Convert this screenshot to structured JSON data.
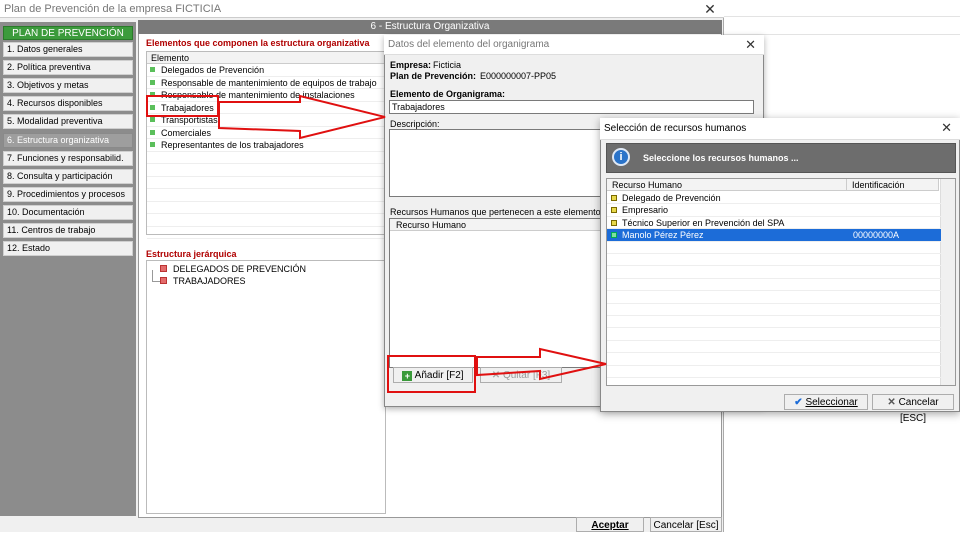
{
  "main": {
    "title": "Plan de Prevención de la empresa FICTICIA",
    "close_glyph": "✕",
    "header": "6 - Estructura Organizativa",
    "nav_title": "PLAN DE PREVENCIÓN",
    "nav_items": [
      "1. Datos generales",
      "2. Política preventiva",
      "3. Objetivos y metas",
      "4. Recursos disponibles",
      "5. Modalidad preventiva",
      "6. Estructura organizativa",
      "7. Funciones y responsabilid.",
      "8. Consulta y participación",
      "9. Procedimientos y procesos",
      "10. Documentación",
      "11. Centros de trabajo",
      "12. Estado"
    ],
    "active_nav_index": 5,
    "elements_title": "Elementos que componen la estructura organizativa",
    "elements_col": "Elemento",
    "elements": [
      "Delegados de Prevención",
      "Responsable de mantenimiento de equipos de trabajo",
      "Responsable de mantenimiento de instalaciones",
      "Trabajadores",
      "Transportistas",
      "Comerciales",
      "Representantes de los trabajadores"
    ],
    "hier_title": "Estructura jerárquica",
    "hier_items": [
      "DELEGADOS DE PREVENCIÓN",
      "TRABAJADORES"
    ],
    "accept_label": "Aceptar",
    "cancel_label": "Cancelar [Esc]"
  },
  "dialog1": {
    "title": "Datos del elemento del organigrama",
    "close_glyph": "✕",
    "empresa_label": "Empresa:",
    "empresa_value": "Ficticia",
    "plan_label": "Plan de Prevención:",
    "plan_value": "E000000007-PP05",
    "elemento_label": "Elemento de Organigrama:",
    "elemento_value": "Trabajadores",
    "descripcion_label": "Descripción:",
    "rh_label": "Recursos Humanos que pertenecen a este elemento del Orga",
    "rh_col": "Recurso Humano",
    "add_label": "Añadir  [F2]",
    "remove_label": "Quitar  [F3]"
  },
  "dialog2": {
    "title": "Selección de recursos humanos",
    "close_glyph": "✕",
    "banner": "Seleccione los recursos humanos ...",
    "info_glyph": "i",
    "col_rh": "Recurso Humano",
    "col_id": "Identificación",
    "rows": [
      {
        "name": "Delegado de Prevención",
        "id": ""
      },
      {
        "name": "Empresario",
        "id": ""
      },
      {
        "name": "Técnico Superior en Prevención del SPA",
        "id": ""
      },
      {
        "name": "Manolo Pérez Pérez",
        "id": "00000000A"
      }
    ],
    "selected_row": 3,
    "select_label": "Seleccionar",
    "cancel_label": "Cancelar [ESC]"
  },
  "colors": {
    "nav_title_bg": "#3c9b3c",
    "section_title": "#b00000",
    "selection": "#1c6cd8",
    "annotation": "#e01010"
  }
}
